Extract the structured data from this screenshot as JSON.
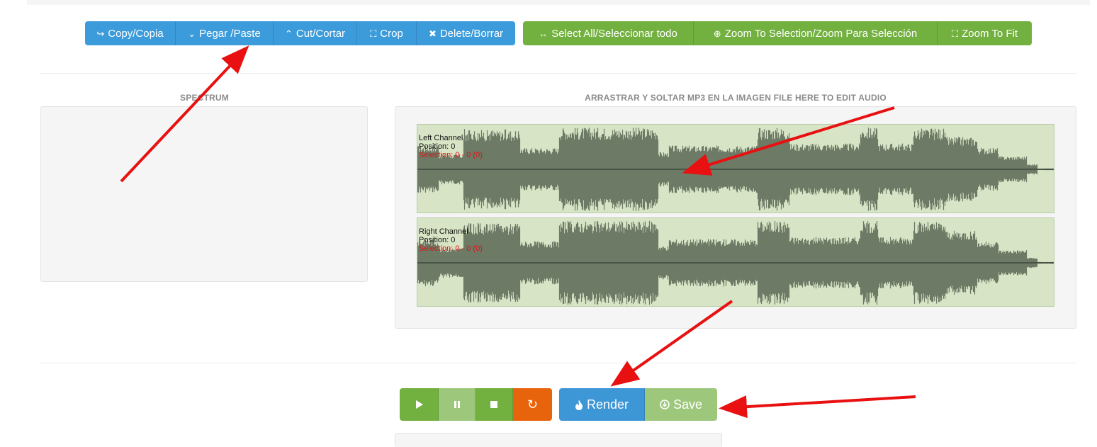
{
  "toolbar_edit": {
    "copy_label": "Copy/Copia",
    "paste_label": "Pegar /Paste",
    "cut_label": "Cut/Cortar",
    "crop_label": "Crop",
    "delete_label": "Delete/Borrar"
  },
  "toolbar_view": {
    "select_all_label": "Select All/Seleccionar todo",
    "zoom_selection_label": "Zoom To Selection/Zoom Para Selección",
    "zoom_fit_label": "Zoom To Fit"
  },
  "spectrum": {
    "title": "SPECTRUM"
  },
  "editor": {
    "title": "ARRASTRAR Y SOLTAR MP3 EN LA IMAGEN FILE HERE TO EDIT AUDIO",
    "left_channel": {
      "name": "Left Channel",
      "position": "Position: 0",
      "selection": "Selection: 0 - 0 (0)"
    },
    "right_channel": {
      "name": "Right Channel",
      "position": "Position: 0",
      "selection": "Selection: 0 - 0 (0)"
    }
  },
  "playback": {
    "render_label": "Render",
    "save_label": "Save"
  },
  "icons": {
    "copy": "share-icon",
    "paste": "chevron-down-icon",
    "cut": "chevron-up-icon",
    "crop": "crop-icon",
    "delete": "close-icon",
    "select_all": "arrows-horizontal-icon",
    "zoom_selection": "plus-circle-icon",
    "zoom_fit": "fullscreen-icon",
    "play": "play-icon",
    "pause": "pause-icon",
    "stop": "stop-icon",
    "reload": "reload-icon",
    "render": "fire-icon",
    "save": "download-icon"
  },
  "colors": {
    "blue": "#3b9bdb",
    "green": "#72b03f",
    "green_light": "#9dc77b",
    "orange": "#e8640c",
    "waveform": "#6d7a66",
    "wave_bg": "#d7e5c6",
    "annotation_arrow": "#e81010"
  }
}
